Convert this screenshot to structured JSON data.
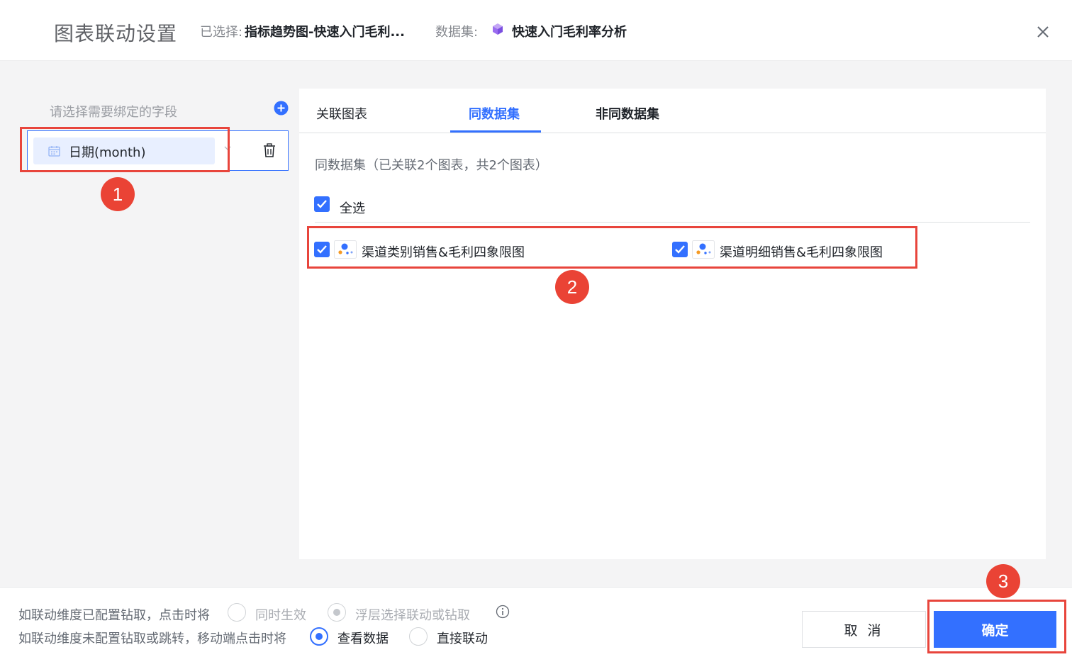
{
  "header": {
    "title": "图表联动设置",
    "selected_label": "已选择:",
    "selected_value": "指标趋势图-快速入门毛利...",
    "dataset_label": "数据集:",
    "dataset_value": "快速入门毛利率分析"
  },
  "left": {
    "hint": "请选择需要绑定的字段",
    "field": "日期(month)"
  },
  "tabs": [
    {
      "label": "关联图表"
    },
    {
      "label": "同数据集",
      "active": true
    },
    {
      "label": "非同数据集"
    }
  ],
  "panel": {
    "description": "同数据集（已关联2个图表，共2个图表）",
    "select_all": "全选",
    "charts": [
      {
        "label": "渠道类别销售&毛利四象限图",
        "checked": true
      },
      {
        "label": "渠道明细销售&毛利四象限图",
        "checked": true
      }
    ]
  },
  "footer": {
    "row1": {
      "label": "如联动维度已配置钻取，点击时将",
      "opt1": "同时生效",
      "opt2": "浮层选择联动或钻取"
    },
    "row2": {
      "label": "如联动维度未配置钻取或跳转，移动端点击时将",
      "opt1": "查看数据",
      "opt2": "直接联动"
    },
    "cancel": "取 消",
    "ok": "确定"
  },
  "annotations": [
    "1",
    "2",
    "3"
  ],
  "colors": {
    "accent": "#3370ff",
    "annotation": "#ea4335"
  }
}
